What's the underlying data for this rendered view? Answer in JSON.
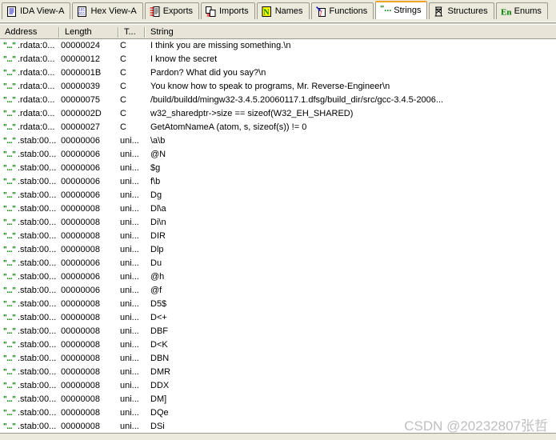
{
  "window": {
    "title": "IDA Strings",
    "watermark": "CSDN @20232807张哲"
  },
  "tabs": [
    {
      "label": "IDA View-A",
      "icon": "ida-view-icon",
      "active": false
    },
    {
      "label": "Hex View-A",
      "icon": "hex-view-icon",
      "active": false
    },
    {
      "label": "Exports",
      "icon": "exports-icon",
      "active": false
    },
    {
      "label": "Imports",
      "icon": "imports-icon",
      "active": false
    },
    {
      "label": "Names",
      "icon": "names-icon",
      "active": false
    },
    {
      "label": "Functions",
      "icon": "functions-icon",
      "active": false
    },
    {
      "label": "Strings",
      "icon": "strings-icon",
      "active": true
    },
    {
      "label": "Structures",
      "icon": "structures-icon",
      "active": false
    },
    {
      "label": "Enums",
      "icon": "enums-icon",
      "active": false
    }
  ],
  "colors": {
    "active_tab_accent": "#f2a32a",
    "string_icon": "#008000",
    "panel_bg": "#eceadd",
    "header_bg": "#e8e5d8",
    "list_bg": "#ffffff",
    "watermark": "#bfbfbf"
  },
  "table": {
    "columns": [
      {
        "key": "address",
        "label": "Address"
      },
      {
        "key": "length",
        "label": "Length"
      },
      {
        "key": "type",
        "label": "T..."
      },
      {
        "key": "string",
        "label": "String"
      }
    ],
    "row_icon": "\"...\"",
    "rows": [
      {
        "address": ".rdata:0...",
        "length": "00000024",
        "type": "C",
        "string": "I think you are missing something.\\n"
      },
      {
        "address": ".rdata:0...",
        "length": "00000012",
        "type": "C",
        "string": "I know the secret"
      },
      {
        "address": ".rdata:0...",
        "length": "0000001B",
        "type": "C",
        "string": "Pardon? What did you say?\\n"
      },
      {
        "address": ".rdata:0...",
        "length": "00000039",
        "type": "C",
        "string": "You know how to speak to programs, Mr. Reverse-Engineer\\n"
      },
      {
        "address": ".rdata:0...",
        "length": "00000075",
        "type": "C",
        "string": "/build/buildd/mingw32-3.4.5.20060117.1.dfsg/build_dir/src/gcc-3.4.5-2006..."
      },
      {
        "address": ".rdata:0...",
        "length": "0000002D",
        "type": "C",
        "string": "w32_sharedptr->size == sizeof(W32_EH_SHARED)"
      },
      {
        "address": ".rdata:0...",
        "length": "00000027",
        "type": "C",
        "string": "GetAtomNameA (atom, s, sizeof(s)) != 0"
      },
      {
        "address": ".stab:00...",
        "length": "00000006",
        "type": "uni...",
        "string": "\\a\\b"
      },
      {
        "address": ".stab:00...",
        "length": "00000006",
        "type": "uni...",
        "string": "@N"
      },
      {
        "address": ".stab:00...",
        "length": "00000006",
        "type": "uni...",
        "string": "$g"
      },
      {
        "address": ".stab:00...",
        "length": "00000006",
        "type": "uni...",
        "string": "f\\b"
      },
      {
        "address": ".stab:00...",
        "length": "00000006",
        "type": "uni...",
        "string": "Dg"
      },
      {
        "address": ".stab:00...",
        "length": "00000008",
        "type": "uni...",
        "string": "Dl\\a"
      },
      {
        "address": ".stab:00...",
        "length": "00000008",
        "type": "uni...",
        "string": "Di\\n"
      },
      {
        "address": ".stab:00...",
        "length": "00000008",
        "type": "uni...",
        "string": "DIR"
      },
      {
        "address": ".stab:00...",
        "length": "00000008",
        "type": "uni...",
        "string": "Dlp"
      },
      {
        "address": ".stab:00...",
        "length": "00000006",
        "type": "uni...",
        "string": "Du"
      },
      {
        "address": ".stab:00...",
        "length": "00000006",
        "type": "uni...",
        "string": "@h"
      },
      {
        "address": ".stab:00...",
        "length": "00000006",
        "type": "uni...",
        "string": "@f"
      },
      {
        "address": ".stab:00...",
        "length": "00000008",
        "type": "uni...",
        "string": "D5$"
      },
      {
        "address": ".stab:00...",
        "length": "00000008",
        "type": "uni...",
        "string": "D<+"
      },
      {
        "address": ".stab:00...",
        "length": "00000008",
        "type": "uni...",
        "string": "DBF"
      },
      {
        "address": ".stab:00...",
        "length": "00000008",
        "type": "uni...",
        "string": "D<K"
      },
      {
        "address": ".stab:00...",
        "length": "00000008",
        "type": "uni...",
        "string": "DBN"
      },
      {
        "address": ".stab:00...",
        "length": "00000008",
        "type": "uni...",
        "string": "DMR"
      },
      {
        "address": ".stab:00...",
        "length": "00000008",
        "type": "uni...",
        "string": "DDX"
      },
      {
        "address": ".stab:00...",
        "length": "00000008",
        "type": "uni...",
        "string": "DM]"
      },
      {
        "address": ".stab:00...",
        "length": "00000008",
        "type": "uni...",
        "string": "DQe"
      },
      {
        "address": ".stab:00...",
        "length": "00000008",
        "type": "uni...",
        "string": "DSi"
      }
    ]
  }
}
